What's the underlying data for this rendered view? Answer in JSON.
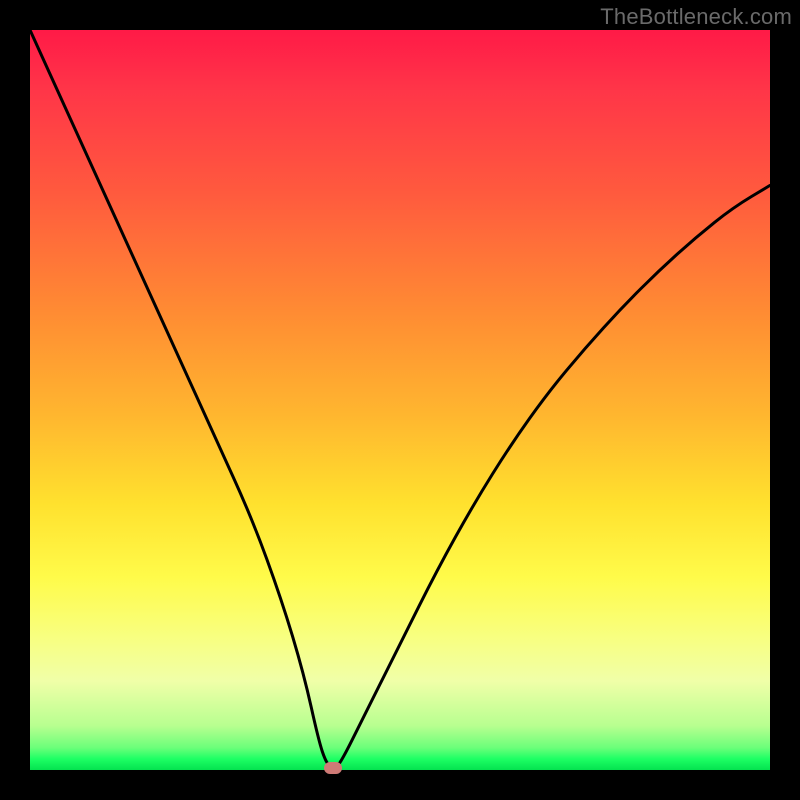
{
  "watermark": "TheBottleneck.com",
  "colors": {
    "frame": "#000000",
    "curve": "#000000",
    "marker": "#cf7a76",
    "gradient_stops": [
      "#ff1a47",
      "#ff3548",
      "#ff5a3e",
      "#ff8b33",
      "#ffb62f",
      "#ffe12e",
      "#fffb4a",
      "#f8ff80",
      "#f0ffa8",
      "#b8ff90",
      "#6bff7a",
      "#1dff64",
      "#04e24f"
    ]
  },
  "chart_data": {
    "type": "line",
    "title": "",
    "xlabel": "",
    "ylabel": "",
    "xlim": [
      0,
      100
    ],
    "ylim": [
      0,
      100
    ],
    "grid": false,
    "legend": false,
    "series": [
      {
        "name": "bottleneck-curve",
        "x": [
          0,
          5,
          10,
          15,
          20,
          25,
          30,
          34,
          37,
          39,
          40,
          41,
          42,
          45,
          50,
          55,
          60,
          65,
          70,
          75,
          80,
          85,
          90,
          95,
          100
        ],
        "values": [
          100,
          89,
          78,
          67,
          56,
          45,
          34,
          23,
          13,
          4,
          1,
          0,
          1,
          7,
          17,
          27,
          36,
          44,
          51,
          57,
          62.5,
          67.5,
          72,
          76,
          79
        ]
      }
    ],
    "annotations": [
      {
        "name": "min-marker",
        "x": 41,
        "y": 0
      }
    ]
  }
}
